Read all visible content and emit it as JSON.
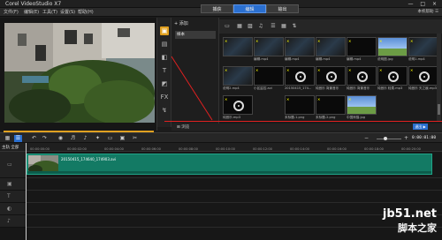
{
  "window": {
    "title": "Corel VideoStudio X7",
    "controls": "— □ ×"
  },
  "menu": {
    "items": [
      "文件(F)",
      "编辑(E)",
      "工具(T)",
      "设置(S)",
      "帮助(H)"
    ],
    "tabs": [
      {
        "label": "捕获",
        "active": false
      },
      {
        "label": "编辑",
        "active": true
      },
      {
        "label": "输出",
        "active": false
      }
    ],
    "help": "本机帮助 ☰"
  },
  "preview": {
    "labels": [
      "项目",
      "素材"
    ],
    "timecode": "00:00:00:00 ◆",
    "controls": [
      "◀◀",
      "◀",
      "▶",
      "▶▶",
      "↺"
    ],
    "progress_percent": 100,
    "accent": "#e0a020"
  },
  "library": {
    "strip_icons": [
      "media-folder-icon",
      "instant-project-icon",
      "transition-icon",
      "title-icon",
      "graphic-icon",
      "filter-icon",
      "path-icon"
    ],
    "add_label": "+ 添加",
    "folder": "样本",
    "browse_label": "⊞ 浏览",
    "ok_label": "退出 ▶",
    "media": [
      {
        "caption": "",
        "kind": "film"
      },
      {
        "caption": "编辑.mp4",
        "kind": "film"
      },
      {
        "caption": "编辑.mp4",
        "kind": "film"
      },
      {
        "caption": "编辑.mp4",
        "kind": "film"
      },
      {
        "caption": "编辑.mp4",
        "kind": "dark"
      },
      {
        "caption": "说明图.jpg",
        "kind": "sky"
      },
      {
        "caption": "说明1.mp4",
        "kind": "film"
      },
      {
        "caption": "说明2.mp4",
        "kind": "film"
      },
      {
        "caption": "小区监控.avi",
        "kind": "dark"
      },
      {
        "caption": "20150415_174...",
        "kind": "disc"
      },
      {
        "caption": "纯音乐 背景音乐",
        "kind": "disc"
      },
      {
        "caption": "纯音乐 背景音乐",
        "kind": "disc"
      },
      {
        "caption": "纯音乐 轻柔.mp3",
        "kind": "disc"
      },
      {
        "caption": "纯音乐 天之痕.mp3",
        "kind": "disc"
      },
      {
        "caption": "纯音乐.mp3",
        "kind": "disc"
      },
      {
        "caption": "",
        "kind": "empty"
      },
      {
        "caption": "未标题-1.png",
        "kind": "dark"
      },
      {
        "caption": "未标题-2.png",
        "kind": "dark"
      },
      {
        "caption": "中国熊猫.jpg",
        "kind": "sky"
      }
    ]
  },
  "timeline": {
    "toolbar_icons": [
      "storyboard-icon",
      "timeline-icon",
      "undo-icon",
      "redo-icon",
      "record-icon",
      "mixer-icon",
      "auto-music-icon",
      "motion-icon",
      "subtitle-icon",
      "multi-camera-icon",
      "split-icon",
      "zoom-icon"
    ],
    "timecode": "0:00:01:00",
    "header_label": "主轨 全部",
    "ruler": [
      "00:00:00:00",
      "00:00:02:00",
      "00:00:04:00",
      "00:00:06:00",
      "00:00:08:00",
      "00:00:10:00",
      "00:00:12:00",
      "00:00:14:00",
      "00:00:16:00",
      "00:00:18:00",
      "00:00:20:00"
    ],
    "clip": {
      "label": "20150415_174640_174903.avi",
      "color": "#137a64"
    },
    "track_icons": [
      "video-track-icon",
      "overlay-track-icon",
      "title-track-icon",
      "voice-track-icon",
      "music-track-icon"
    ]
  },
  "watermark": {
    "line1": "jb51.net",
    "line2": "脚本之家"
  }
}
